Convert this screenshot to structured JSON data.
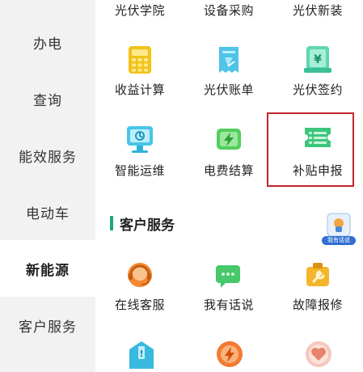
{
  "sidebar": {
    "items": [
      {
        "label": "办电"
      },
      {
        "label": "查询"
      },
      {
        "label": "能效服务"
      },
      {
        "label": "电动车"
      },
      {
        "label": "新能源",
        "active": true
      },
      {
        "label": "客户服务"
      }
    ]
  },
  "top_row": [
    "光伏学院",
    "设备采购",
    "光伏新装"
  ],
  "grid1": [
    {
      "label": "收益计算",
      "icon": "calculator-icon"
    },
    {
      "label": "光伏账单",
      "icon": "receipt-icon"
    },
    {
      "label": "光伏签约",
      "icon": "yen-contract-icon"
    }
  ],
  "grid2": [
    {
      "label": "智能运维",
      "icon": "monitor-icon"
    },
    {
      "label": "电费结算",
      "icon": "battery-icon"
    },
    {
      "label": "补贴申报",
      "icon": "ticket-icon"
    }
  ],
  "customer_service": {
    "title": "客户服务",
    "badge_text": "我有话说",
    "items": [
      {
        "label": "在线客服",
        "icon": "headset-icon"
      },
      {
        "label": "我有话说",
        "icon": "chat-icon"
      },
      {
        "label": "故障报修",
        "icon": "repair-icon"
      }
    ],
    "partial_icons": [
      "mail-alert-icon",
      "lightning-icon",
      "heart-icon"
    ]
  },
  "colors": {
    "accent_red": "#c0272d",
    "section_bar": "#1fa47f"
  }
}
